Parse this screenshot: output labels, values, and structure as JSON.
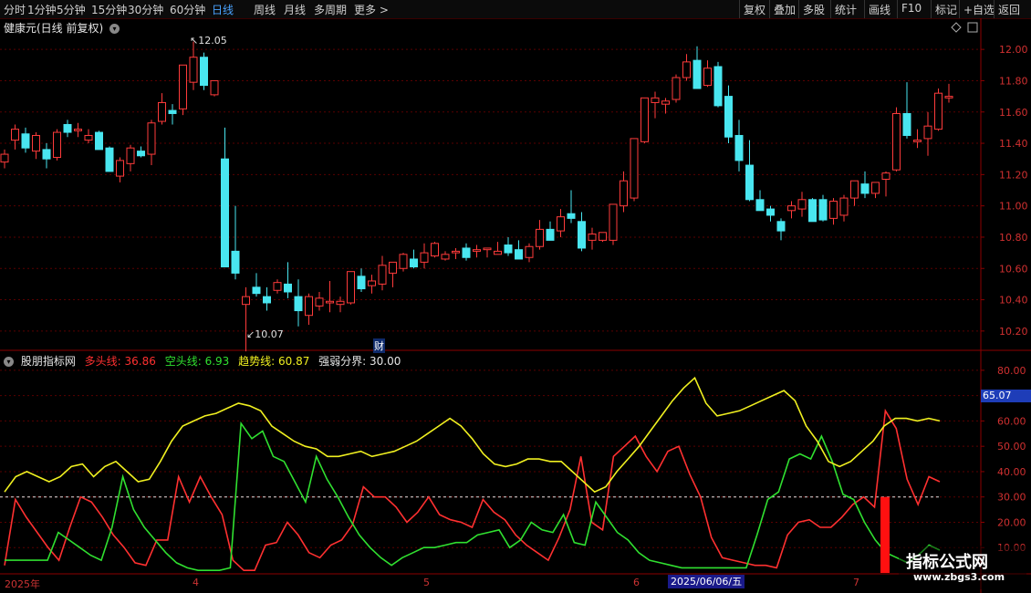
{
  "toolbar": {
    "periods": [
      "分时",
      "1分钟",
      "5分钟",
      "15分钟",
      "30分钟",
      "60分钟",
      "日线",
      "周线",
      "月线",
      "多周期",
      "更多 >"
    ],
    "active_period": "日线",
    "actions": [
      "复权",
      "叠加",
      "多股",
      "统计",
      "画线",
      "F10",
      "标记",
      "+自选",
      "返回"
    ]
  },
  "stock": {
    "title": "健康元(日线 前复权)"
  },
  "price_axis": [
    "12.00",
    "11.80",
    "11.60",
    "11.40",
    "11.20",
    "11.00",
    "10.80",
    "10.60",
    "10.40",
    "10.20"
  ],
  "annotations": {
    "high": "12.05",
    "low": "10.07",
    "cai": "财"
  },
  "indicator": {
    "name": "股朋指标网",
    "bull_label": "多头线: 36.86",
    "bear_label": "空头线: 6.93",
    "trend_label": "趋势线: 60.87",
    "boundary_label": "强弱分界: 30.00",
    "colors": {
      "bull": "#ff3030",
      "bear": "#30e030",
      "trend": "#f0f020",
      "boundary": "#e0e0e0"
    }
  },
  "indicator_axis": [
    "80.00",
    "70.00",
    "60.00",
    "50.00",
    "40.00",
    "30.00",
    "20.00",
    "10.00"
  ],
  "price_tag": "65.07",
  "dates": {
    "start": "2025年",
    "m4": "4",
    "m5": "5",
    "m6": "6",
    "highlight": "2025/06/06/五",
    "m7": "7"
  },
  "watermark": {
    "title": "指标公式网",
    "url": "www.zbgs3.com"
  },
  "chart_data": [
    {
      "type": "candlestick",
      "title": "健康元(日线 前复权)",
      "ylim": [
        10.1,
        12.1
      ],
      "candles": [
        [
          11.28,
          11.36,
          11.24,
          11.33
        ],
        [
          11.42,
          11.52,
          11.36,
          11.49
        ],
        [
          11.46,
          11.5,
          11.34,
          11.37
        ],
        [
          11.35,
          11.47,
          11.3,
          11.45
        ],
        [
          11.36,
          11.4,
          11.24,
          11.3
        ],
        [
          11.31,
          11.49,
          11.29,
          11.47
        ],
        [
          11.52,
          11.55,
          11.44,
          11.47
        ],
        [
          11.48,
          11.53,
          11.44,
          11.49
        ],
        [
          11.42,
          11.49,
          11.4,
          11.45
        ],
        [
          11.47,
          11.48,
          11.36,
          11.36
        ],
        [
          11.37,
          11.38,
          11.22,
          11.22
        ],
        [
          11.19,
          11.31,
          11.15,
          11.29
        ],
        [
          11.27,
          11.39,
          11.22,
          11.37
        ],
        [
          11.35,
          11.38,
          11.31,
          11.32
        ],
        [
          11.33,
          11.55,
          11.26,
          11.53
        ],
        [
          11.54,
          11.72,
          11.52,
          11.66
        ],
        [
          11.61,
          11.65,
          11.52,
          11.59
        ],
        [
          11.62,
          11.8,
          11.58,
          11.9
        ],
        [
          11.79,
          12.05,
          11.74,
          11.95
        ],
        [
          11.95,
          11.98,
          11.74,
          11.77
        ],
        [
          11.71,
          11.8,
          11.7,
          11.8
        ],
        [
          11.3,
          11.5,
          10.62,
          10.61
        ],
        [
          10.71,
          11.0,
          10.53,
          10.57
        ],
        [
          10.37,
          10.48,
          10.07,
          10.42
        ],
        [
          10.48,
          10.57,
          10.42,
          10.44
        ],
        [
          10.42,
          10.48,
          10.33,
          10.38
        ],
        [
          10.46,
          10.53,
          10.44,
          10.51
        ],
        [
          10.5,
          10.64,
          10.41,
          10.45
        ],
        [
          10.42,
          10.53,
          10.23,
          10.33
        ],
        [
          10.3,
          10.44,
          10.24,
          10.42
        ],
        [
          10.36,
          10.45,
          10.33,
          10.41
        ],
        [
          10.38,
          10.52,
          10.32,
          10.39
        ],
        [
          10.37,
          10.42,
          10.32,
          10.39
        ],
        [
          10.38,
          10.56,
          10.37,
          10.58
        ],
        [
          10.55,
          10.6,
          10.45,
          10.47
        ],
        [
          10.49,
          10.56,
          10.44,
          10.52
        ],
        [
          10.5,
          10.68,
          10.46,
          10.62
        ],
        [
          10.57,
          10.63,
          10.48,
          10.64
        ],
        [
          10.6,
          10.7,
          10.58,
          10.69
        ],
        [
          10.66,
          10.72,
          10.6,
          10.61
        ],
        [
          10.64,
          10.76,
          10.6,
          10.7
        ],
        [
          10.68,
          10.77,
          10.67,
          10.76
        ],
        [
          10.66,
          10.71,
          10.65,
          10.69
        ],
        [
          10.7,
          10.73,
          10.66,
          10.71
        ],
        [
          10.73,
          10.76,
          10.65,
          10.67
        ],
        [
          10.71,
          10.75,
          10.67,
          10.72
        ],
        [
          10.72,
          10.73,
          10.67,
          10.73
        ],
        [
          10.69,
          10.77,
          10.69,
          10.71
        ],
        [
          10.75,
          10.8,
          10.68,
          10.7
        ],
        [
          10.72,
          10.78,
          10.66,
          10.66
        ],
        [
          10.67,
          10.76,
          10.64,
          10.74
        ],
        [
          10.74,
          10.91,
          10.72,
          10.85
        ],
        [
          10.85,
          10.9,
          10.79,
          10.78
        ],
        [
          10.84,
          10.98,
          10.8,
          10.93
        ],
        [
          10.95,
          11.1,
          10.89,
          10.92
        ],
        [
          10.9,
          10.96,
          10.71,
          10.73
        ],
        [
          10.78,
          10.86,
          10.72,
          10.82
        ],
        [
          10.78,
          10.82,
          10.77,
          10.83
        ],
        [
          10.78,
          11.0,
          10.75,
          11.01
        ],
        [
          11.0,
          11.22,
          10.96,
          11.16
        ],
        [
          11.05,
          11.43,
          11.03,
          11.43
        ],
        [
          11.41,
          11.64,
          11.4,
          11.69
        ],
        [
          11.66,
          11.73,
          11.56,
          11.69
        ],
        [
          11.65,
          11.69,
          11.59,
          11.67
        ],
        [
          11.68,
          11.84,
          11.66,
          11.82
        ],
        [
          11.82,
          11.97,
          11.8,
          11.92
        ],
        [
          11.93,
          12.02,
          11.76,
          11.75
        ],
        [
          11.77,
          11.93,
          11.76,
          11.88
        ],
        [
          11.89,
          11.92,
          11.63,
          11.64
        ],
        [
          11.7,
          11.77,
          11.4,
          11.44
        ],
        [
          11.45,
          11.55,
          11.22,
          11.29
        ],
        [
          11.26,
          11.42,
          11.03,
          11.04
        ],
        [
          11.04,
          11.1,
          10.97,
          10.97
        ],
        [
          10.98,
          11.0,
          10.9,
          10.94
        ],
        [
          10.9,
          10.92,
          10.78,
          10.84
        ],
        [
          10.97,
          11.03,
          10.92,
          11.0
        ],
        [
          10.98,
          11.09,
          10.93,
          11.04
        ],
        [
          11.04,
          11.05,
          10.9,
          10.9
        ],
        [
          11.04,
          11.07,
          10.9,
          10.91
        ],
        [
          10.92,
          11.05,
          10.88,
          11.03
        ],
        [
          10.94,
          11.07,
          10.9,
          11.05
        ],
        [
          11.05,
          11.12,
          11.0,
          11.16
        ],
        [
          11.14,
          11.22,
          11.05,
          11.08
        ],
        [
          11.08,
          11.15,
          11.05,
          11.15
        ],
        [
          11.17,
          11.22,
          11.06,
          11.21
        ],
        [
          11.23,
          11.63,
          11.22,
          11.59
        ],
        [
          11.59,
          11.79,
          11.43,
          11.45
        ],
        [
          11.41,
          11.49,
          11.37,
          11.42
        ],
        [
          11.43,
          11.6,
          11.32,
          11.51
        ],
        [
          11.49,
          11.75,
          11.48,
          11.72
        ],
        [
          11.69,
          11.78,
          11.66,
          11.7
        ]
      ]
    },
    {
      "type": "line",
      "title": "股朋指标网",
      "ylim": [
        0,
        85
      ],
      "series": [
        {
          "name": "多头线",
          "values": [
            3,
            29,
            22,
            16,
            10,
            5,
            18,
            30,
            28,
            22,
            15,
            10,
            4,
            3,
            13,
            13,
            38,
            28,
            38,
            30,
            23,
            5,
            1,
            1,
            11,
            12,
            20,
            15,
            8,
            6,
            11,
            13,
            19,
            34,
            30,
            30,
            26,
            20,
            24,
            30,
            23,
            21,
            20,
            18,
            29,
            24,
            21,
            15,
            11,
            8,
            5,
            14,
            25,
            46,
            20,
            17,
            46,
            50,
            54,
            46,
            40,
            48,
            50,
            39,
            30,
            14,
            6,
            5,
            4,
            3,
            3,
            2,
            15,
            20,
            21,
            18,
            18,
            22,
            27,
            30,
            26,
            64,
            57,
            37,
            27,
            38,
            36
          ]
        },
        {
          "name": "空头线",
          "values": [
            5,
            5,
            5,
            5,
            5,
            16,
            13,
            10,
            7,
            5,
            18,
            38,
            25,
            18,
            13,
            8,
            4,
            2,
            1,
            1,
            1,
            2,
            59,
            53,
            56,
            46,
            44,
            36,
            28,
            46,
            37,
            30,
            22,
            15,
            10,
            6,
            3,
            6,
            8,
            10,
            10,
            11,
            12,
            12,
            15,
            16,
            17,
            10,
            13,
            20,
            17,
            16,
            23,
            12,
            11,
            28,
            22,
            16,
            13,
            8,
            5,
            4,
            3,
            2,
            2,
            2,
            2,
            2,
            2,
            2,
            15,
            29,
            32,
            45,
            47,
            45,
            54,
            44,
            31,
            29,
            20,
            13,
            8,
            6,
            4,
            7,
            11,
            9
          ]
        },
        {
          "name": "趋势线",
          "values": [
            32,
            38,
            40,
            38,
            36,
            38,
            42,
            43,
            38,
            42,
            44,
            40,
            36,
            37,
            44,
            52,
            58,
            60,
            62,
            63,
            65,
            67,
            66,
            64,
            58,
            55,
            52,
            50,
            49,
            46,
            46,
            47,
            48,
            46,
            47,
            48,
            50,
            52,
            55,
            58,
            61,
            58,
            53,
            47,
            43,
            42,
            43,
            45,
            45,
            44,
            44,
            40,
            36,
            32,
            34,
            40,
            45,
            50,
            56,
            62,
            68,
            73,
            77,
            67,
            62,
            63,
            64,
            66,
            68,
            70,
            72,
            68,
            58,
            52,
            44,
            42,
            44,
            48,
            52,
            58,
            61,
            61,
            60,
            61,
            60
          ]
        },
        {
          "name": "强弱分界",
          "values": [
            30
          ]
        }
      ]
    }
  ]
}
